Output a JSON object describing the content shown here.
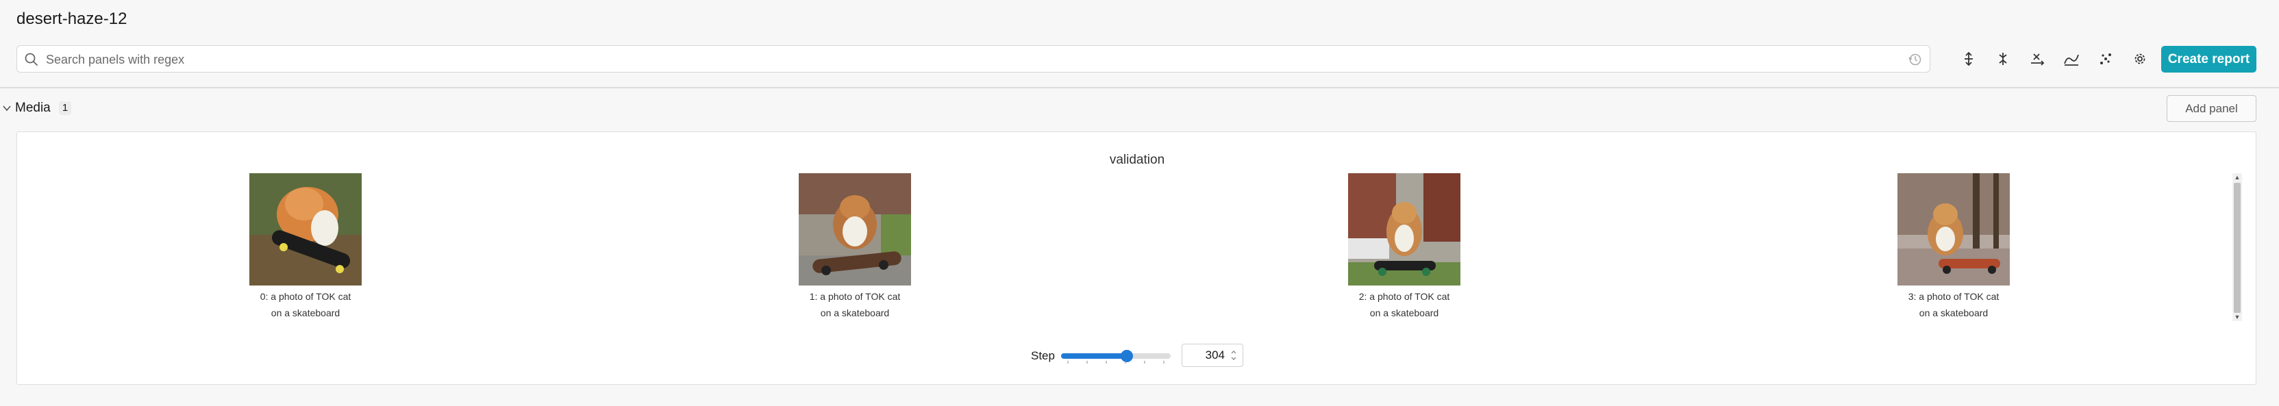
{
  "run": {
    "title": "desert-haze-12"
  },
  "search": {
    "placeholder": "Search panels with regex",
    "value": ""
  },
  "toolbar": {
    "icons": [
      "expand-collapse-icon",
      "asterisk-icon",
      "x-axis-icon",
      "smoothing-icon",
      "outliers-icon",
      "settings-gear-icon"
    ],
    "create_report_label": "Create report",
    "accent_color": "#13a2b5"
  },
  "section": {
    "title": "Media",
    "count": "1",
    "add_panel_label": "Add panel"
  },
  "panel": {
    "title": "validation",
    "media": [
      {
        "caption_line1": "0: a photo of TOK cat",
        "caption_line2": "on a skateboard"
      },
      {
        "caption_line1": "1: a photo of TOK cat",
        "caption_line2": "on a skateboard"
      },
      {
        "caption_line1": "2: a photo of TOK cat",
        "caption_line2": "on a skateboard"
      },
      {
        "caption_line1": "3: a photo of TOK cat",
        "caption_line2": "on a skateboard"
      }
    ],
    "step": {
      "label": "Step",
      "value": "304",
      "slider_fraction": 0.6
    }
  }
}
